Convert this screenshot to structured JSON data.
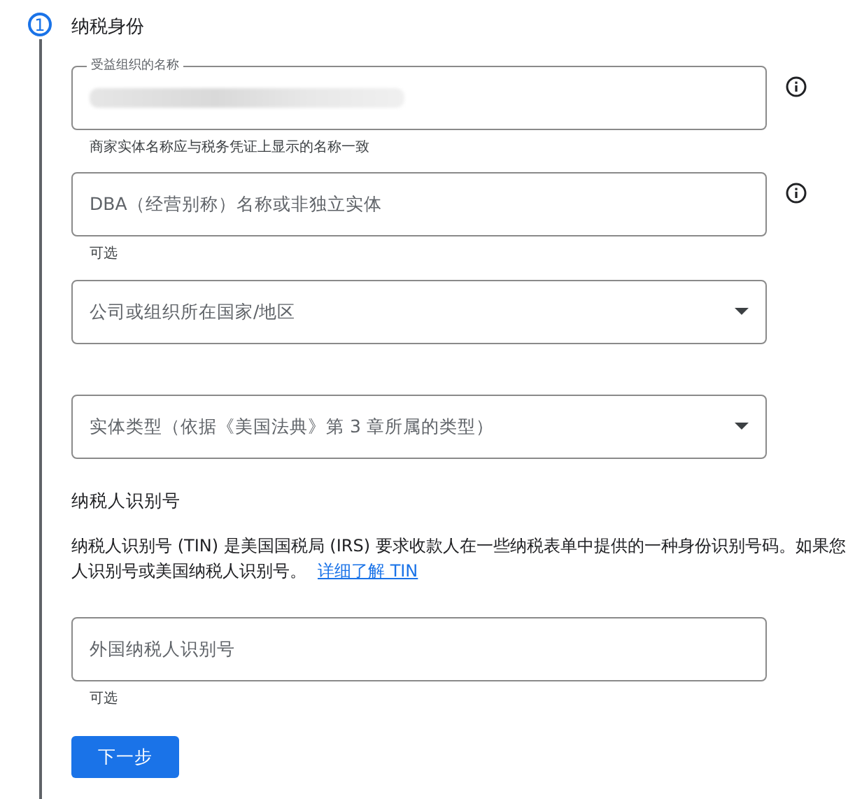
{
  "step": {
    "number": "1",
    "title": "纳税身份"
  },
  "fields": [
    {
      "kind": "text",
      "label": "受益组织的名称",
      "redacted": true,
      "info": true,
      "helper": "商家实体名称应与税务凭证上显示的名称一致"
    },
    {
      "kind": "text",
      "placeholder": "DBA（经营别称）名称或非独立实体",
      "info": true,
      "helper": "可选"
    },
    {
      "kind": "select",
      "placeholder": "公司或组织所在国家/地区",
      "info": false
    },
    {
      "kind": "select",
      "placeholder": "实体类型（依据《美国法典》第 3 章所属的类型）",
      "info": false
    }
  ],
  "tin": {
    "heading": "纳税人识别号",
    "description_lines": [
      "纳税人识别号 (TIN) 是美国国税局 (IRS) 要求收款人在一些纳税表单中提供的一种身份识别号码。如果您",
      "人识别号或美国纳税人识别号。"
    ],
    "link": "详细了解 TIN",
    "field": {
      "kind": "text",
      "placeholder": "外国纳税人识别号",
      "info": false,
      "helper": "可选"
    }
  },
  "buttons": [
    "下一步"
  ]
}
